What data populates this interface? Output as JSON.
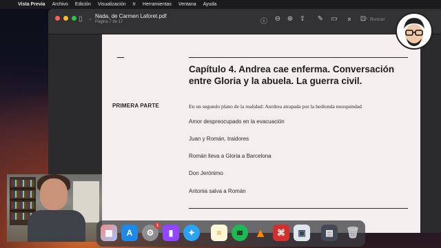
{
  "menubar": {
    "app_name": "Vista Previa",
    "items": [
      "Archivo",
      "Edición",
      "Visualización",
      "Ir",
      "Herramientas",
      "Ventana",
      "Ayuda"
    ]
  },
  "window": {
    "title": "Nada, de Carmen Laforet.pdf",
    "subtitle": "Página 7 de 17",
    "search_placeholder": "Buscar"
  },
  "page": {
    "part_label": "PRIMERA PARTE",
    "chapter_title": "Capítulo 4. Andrea cae enferma. Conversación entre Gloria y la abuela. La guerra civil.",
    "items": [
      "En un segundo plano de la realidad: Anrdrea atrapada por la hedionda mezquindad",
      "Amor despreocupado  en la evacuación",
      "Juan y Román, traidores",
      "Román lleva a Gloria a Barcelona",
      "Don Jerónimo",
      "Antonia salva a Román"
    ]
  },
  "dock": {
    "icons": [
      "launchpad-icon",
      "app-store-icon",
      "system-preferences-icon",
      "twitch-icon",
      "safari-icon",
      "notes-icon",
      "spotify-icon",
      "vlc-icon",
      "acrobat-icon",
      "preview-icon",
      "screen-recorder-icon",
      "trash-icon"
    ],
    "system_preferences_badge": "1"
  },
  "colors": {
    "page_bg": "#f4eeee",
    "window_bg": "#2a2a2c",
    "close": "#ff5f57",
    "minimize": "#febc2e",
    "zoom": "#28c840"
  }
}
